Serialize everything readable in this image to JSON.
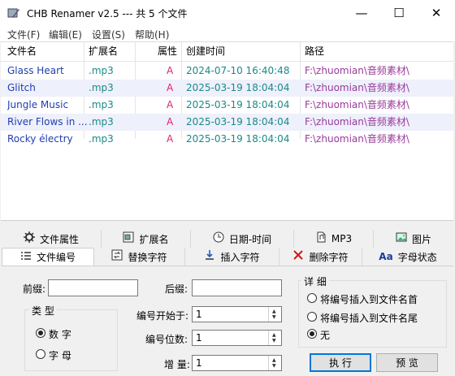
{
  "window": {
    "title": "CHB Renamer v2.5 --- 共 5 个文件",
    "minimize_glyph": "—",
    "maximize_glyph": "☐",
    "close_glyph": "✕"
  },
  "menu": [
    "文件(F)",
    "编辑(E)",
    "设置(S)",
    "帮助(H)"
  ],
  "table": {
    "columns": [
      "文件名",
      "扩展名",
      "属性",
      "创建时间",
      "路径"
    ],
    "rows": [
      {
        "name": "Glass Heart",
        "ext": ".mp3",
        "attr": "A",
        "created": "2024-07-10 16:40:48",
        "path": "F:\\zhuomian\\音频素材\\"
      },
      {
        "name": "Glitch",
        "ext": ".mp3",
        "attr": "A",
        "created": "2025-03-19 18:04:04",
        "path": "F:\\zhuomian\\音频素材\\"
      },
      {
        "name": "Jungle Music",
        "ext": ".mp3",
        "attr": "A",
        "created": "2025-03-19 18:04:04",
        "path": "F:\\zhuomian\\音频素材\\"
      },
      {
        "name": "River Flows in ...",
        "ext": ".mp3",
        "attr": "A",
        "created": "2025-03-19 18:04:04",
        "path": "F:\\zhuomian\\音频素材\\"
      },
      {
        "name": "Rocky électry",
        "ext": ".mp3",
        "attr": "A",
        "created": "2025-03-19 18:04:04",
        "path": "F:\\zhuomian\\音频素材\\"
      }
    ]
  },
  "tabs_row1": [
    {
      "label": "文件属性",
      "icon": "file-attributes-icon"
    },
    {
      "label": "扩展名",
      "icon": "extension-icon"
    },
    {
      "label": "日期-时间",
      "icon": "clock-icon"
    },
    {
      "label": "MP3",
      "icon": "mp3-icon"
    },
    {
      "label": "图片",
      "icon": "picture-icon"
    }
  ],
  "tabs_row2": [
    {
      "label": "文件编号",
      "icon": "numbered-list-icon",
      "active": true
    },
    {
      "label": "替换字符",
      "icon": "replace-icon"
    },
    {
      "label": "插入字符",
      "icon": "insert-icon"
    },
    {
      "label": "删除字符",
      "icon": "delete-icon"
    },
    {
      "label": "字母状态",
      "icon": "letter-case-icon",
      "icon_text": "Aa"
    }
  ],
  "form": {
    "prefix_label": "前缀:",
    "prefix_value": "",
    "suffix_label": "后缀:",
    "suffix_value": "",
    "type_group_title": "类 型",
    "type_options": [
      {
        "label": "数 字",
        "selected": true
      },
      {
        "label": "字 母",
        "selected": false
      }
    ],
    "start_label": "编号开始于:",
    "start_value": "1",
    "digits_label": "编号位数:",
    "digits_value": "1",
    "increment_label": "增 量:",
    "increment_value": "1",
    "detail_group_title": "详 细",
    "detail_options": [
      {
        "label": "将编号插入到文件名首",
        "selected": false
      },
      {
        "label": "将编号插入到文件名尾",
        "selected": false
      },
      {
        "label": "无",
        "selected": true
      }
    ],
    "execute_button": "执 行",
    "preview_button": "预 览"
  },
  "colors": {
    "name": "#1f3fb0",
    "ext": "#1a8a8a",
    "attr": "#e0207a",
    "time": "#1a8a8a",
    "path": "#9a3a9a",
    "row_alt": "#eef0fb"
  }
}
